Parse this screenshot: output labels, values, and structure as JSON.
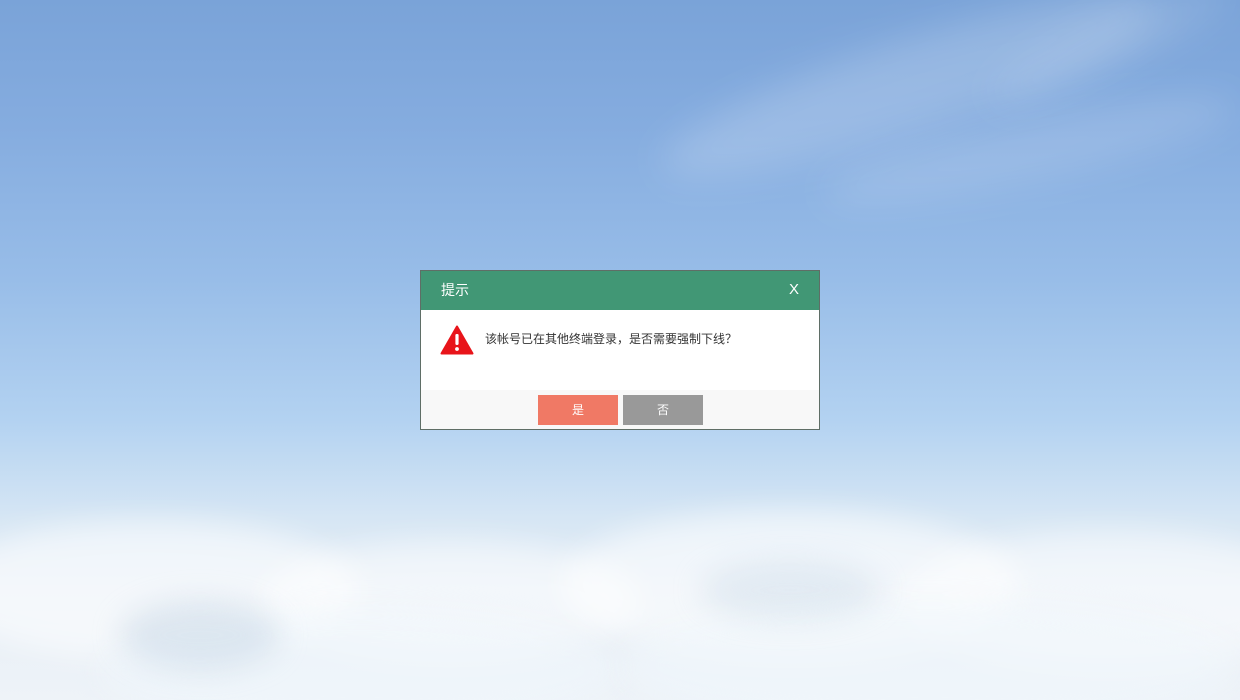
{
  "dialog": {
    "title": "提示",
    "close_label": "X",
    "message": "该帐号已在其他终端登录，是否需要强制下线？",
    "icon": "warning-icon",
    "buttons": {
      "yes_label": "是",
      "no_label": "否"
    }
  },
  "colors": {
    "header": "#419775",
    "yes_button": "#f07965",
    "no_button": "#999999",
    "warning": "#e8141a"
  }
}
